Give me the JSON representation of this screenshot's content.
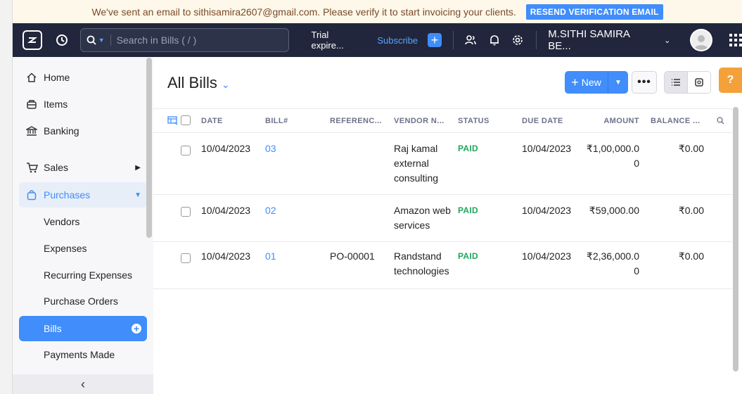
{
  "banner": {
    "message": "We've sent an email to sithisamira2607@gmail.com. Please verify it to start invoicing your clients.",
    "resend_label": "RESEND VERIFICATION EMAIL"
  },
  "topbar": {
    "search_placeholder": "Search in Bills ( / )",
    "trial_text": "Trial expire...",
    "subscribe_label": "Subscribe",
    "org_name": "M.SITHI SAMIRA BE..."
  },
  "sidebar": {
    "items": [
      {
        "label": "Home",
        "icon": "home-icon"
      },
      {
        "label": "Items",
        "icon": "items-icon"
      },
      {
        "label": "Banking",
        "icon": "bank-icon"
      },
      {
        "label": "Sales",
        "icon": "cart-icon"
      },
      {
        "label": "Purchases",
        "icon": "bag-icon"
      }
    ],
    "purchases_sub": [
      "Vendors",
      "Expenses",
      "Recurring Expenses",
      "Purchase Orders",
      "Bills",
      "Payments Made"
    ]
  },
  "main": {
    "title": "All Bills",
    "new_label": "New",
    "columns": [
      "DATE",
      "BILL#",
      "REFERENC...",
      "VENDOR N...",
      "STATUS",
      "DUE DATE",
      "AMOUNT",
      "BALANCE ..."
    ],
    "rows": [
      {
        "date": "10/04/2023",
        "bill": "03",
        "reference": "",
        "vendor": [
          "Raj kamal",
          "external",
          "consulting"
        ],
        "status": "PAID",
        "due_date": "10/04/2023",
        "amount": [
          "₹1,00,000.0",
          "0"
        ],
        "balance": "₹0.00"
      },
      {
        "date": "10/04/2023",
        "bill": "02",
        "reference": "",
        "vendor": [
          "Amazon web",
          "services"
        ],
        "status": "PAID",
        "due_date": "10/04/2023",
        "amount": [
          "₹59,000.00"
        ],
        "balance": "₹0.00"
      },
      {
        "date": "10/04/2023",
        "bill": "01",
        "reference": "PO-00001",
        "vendor": [
          "Randstand",
          "technologies"
        ],
        "status": "PAID",
        "due_date": "10/04/2023",
        "amount": [
          "₹2,36,000.0",
          "0"
        ],
        "balance": "₹0.00"
      }
    ]
  },
  "colors": {
    "accent": "#408dfb",
    "topbar": "#21263c",
    "paid": "#22a55d",
    "help": "#f4a13a"
  }
}
